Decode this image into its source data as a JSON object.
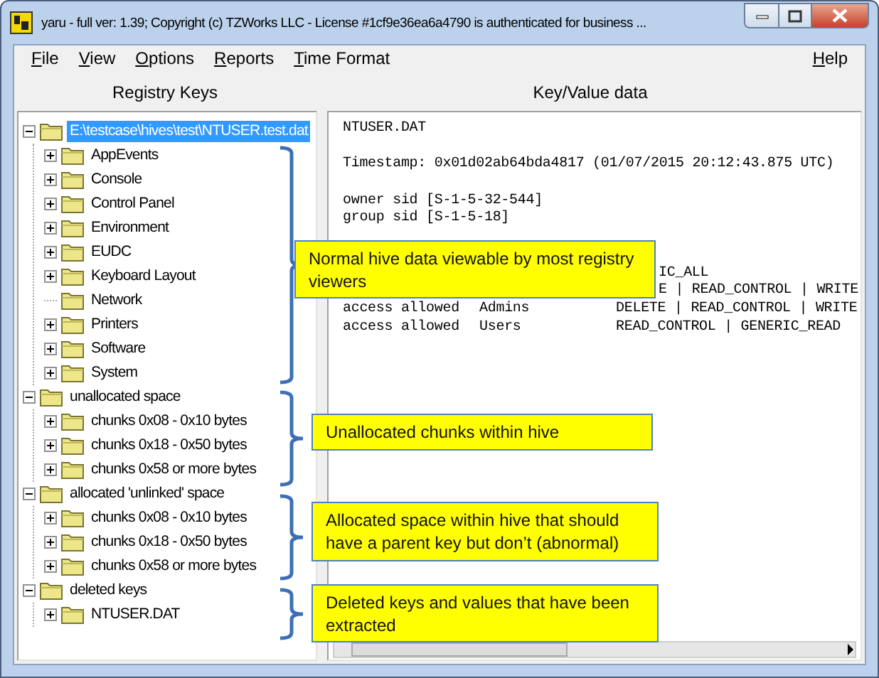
{
  "window": {
    "title": "yaru - full ver: 1.39; Copyright (c) TZWorks LLC - License #1cf9e36ea6a4790 is authenticated for business ..."
  },
  "menu": {
    "items": [
      "File",
      "View",
      "Options",
      "Reports",
      "Time Format"
    ],
    "help": "Help"
  },
  "panes": {
    "left_header": "Registry Keys",
    "right_header": "Key/Value data"
  },
  "tree": [
    {
      "label": "E:\\testcase\\hives\\test\\NTUSER.test.dat",
      "expanded": true,
      "selected": true,
      "children": [
        {
          "label": "AppEvents",
          "expanded": false,
          "selected": false
        },
        {
          "label": "Console",
          "expanded": false,
          "selected": false
        },
        {
          "label": "Control Panel",
          "expanded": false,
          "selected": false
        },
        {
          "label": "Environment",
          "expanded": false,
          "selected": false
        },
        {
          "label": "EUDC",
          "expanded": false,
          "selected": false
        },
        {
          "label": "Keyboard Layout",
          "expanded": false,
          "selected": false
        },
        {
          "label": "Network",
          "selected": false
        },
        {
          "label": "Printers",
          "expanded": false,
          "selected": false
        },
        {
          "label": "Software",
          "expanded": false,
          "selected": false
        },
        {
          "label": "System",
          "expanded": false,
          "selected": false
        }
      ]
    },
    {
      "label": "unallocated space",
      "expanded": true,
      "selected": false,
      "children": [
        {
          "label": "chunks 0x08 - 0x10 bytes",
          "expanded": false,
          "selected": false
        },
        {
          "label": "chunks 0x18 - 0x50 bytes",
          "expanded": false,
          "selected": false
        },
        {
          "label": "chunks 0x58 or more bytes",
          "expanded": false,
          "selected": false
        }
      ]
    },
    {
      "label": "allocated 'unlinked' space",
      "expanded": true,
      "selected": false,
      "children": [
        {
          "label": "chunks 0x08 - 0x10 bytes",
          "expanded": false,
          "selected": false
        },
        {
          "label": "chunks 0x18 - 0x50 bytes",
          "expanded": false,
          "selected": false
        },
        {
          "label": "chunks 0x58 or more bytes",
          "expanded": false,
          "selected": false
        }
      ]
    },
    {
      "label": "deleted keys",
      "expanded": true,
      "selected": false,
      "children": [
        {
          "label": "NTUSER.DAT",
          "expanded": false,
          "selected": false
        }
      ]
    }
  ],
  "data_lines": [
    {
      "kind": "text",
      "text": "NTUSER.DAT"
    },
    {
      "kind": "blank"
    },
    {
      "kind": "text",
      "text": "Timestamp: 0x01d02ab64bda4817 (01/07/2015 20:12:43.875 UTC)"
    },
    {
      "kind": "blank"
    },
    {
      "kind": "text",
      "text": "owner sid [S-1-5-32-544]"
    },
    {
      "kind": "text",
      "text": "group sid [S-1-5-18]"
    },
    {
      "kind": "blank"
    },
    {
      "kind": "blank"
    },
    {
      "kind": "partial",
      "text": "IC_ALL"
    },
    {
      "kind": "partial",
      "text": "E | READ_CONTROL | WRITE"
    },
    {
      "kind": "ace",
      "type": "access allowed",
      "who": "Admins",
      "rights": "DELETE | READ_CONTROL | WRITE"
    },
    {
      "kind": "ace",
      "type": "access allowed",
      "who": "Users",
      "rights": "READ_CONTROL | GENERIC_READ"
    }
  ],
  "callouts": [
    {
      "text": "Normal hive data viewable by most registry viewers"
    },
    {
      "text": "Unallocated chunks within hive"
    },
    {
      "text": "Allocated space within hive that should have a parent key but don’t (abnormal)"
    },
    {
      "text": "Deleted keys and values that have been extracted"
    }
  ]
}
